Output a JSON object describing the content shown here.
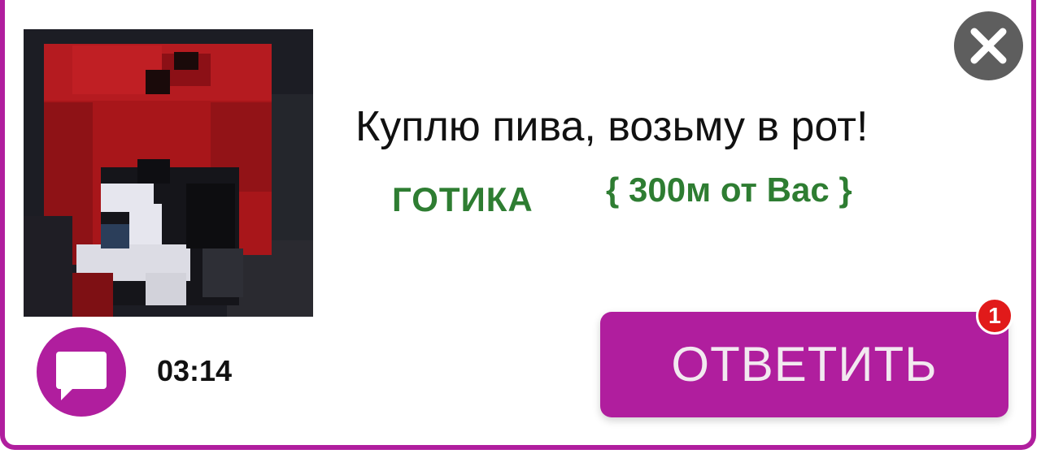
{
  "notification": {
    "message": "Куплю пива, возьму в рот!",
    "category": "ГОТИКА",
    "distance": "{ 300м от Вас }",
    "time": "03:14"
  },
  "actions": {
    "reply_label": "ОТВЕТИТЬ",
    "reply_badge_count": "1"
  },
  "icons": {
    "close": "close-icon",
    "chat": "chat-bubble-icon"
  },
  "colors": {
    "accent": "#b01e9e",
    "category_text": "#2e7d32",
    "badge": "#e11a1a",
    "close_button": "#5e5e5e"
  }
}
